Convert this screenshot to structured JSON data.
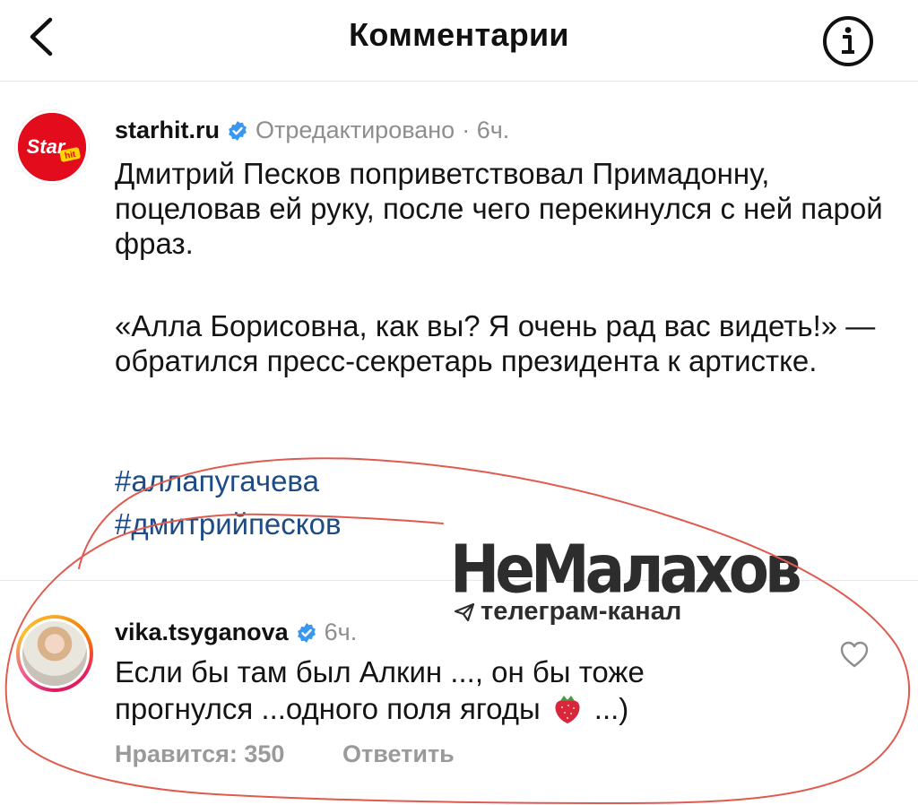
{
  "header": {
    "title": "Комментарии",
    "back_icon": "chevron-left-icon",
    "info_icon": "info-icon"
  },
  "post": {
    "avatar_text": "Star",
    "avatar_badge": "hit",
    "username": "starhit.ru",
    "edited": "Отредактировано",
    "time": "· 6ч.",
    "paragraph1": "Дмитрий Песков поприветствовал Примадонну, поцеловав ей руку, после чего перекинулся с ней парой фраз.",
    "paragraph2": "«Алла Борисовна, как вы? Я очень рад вас видеть!» — обратился пресс-секретарь президента к артистке.",
    "hashtags": [
      "#аллапугачева",
      "#дмитрийпесков"
    ]
  },
  "comment": {
    "username": "vika.tsyganova",
    "time": "6ч.",
    "text_line1": "Если бы там был Алкин ..., он бы тоже",
    "text_line2": "прогнулся ...одного поля ягоды",
    "text_line2_end": " ...)",
    "emoji": "strawberry",
    "likes": "Нравится: 350",
    "reply": "Ответить"
  },
  "watermark": {
    "title": "НеМалахов",
    "subtitle": "телеграм-канал",
    "icon": "paper-plane-icon"
  },
  "colors": {
    "hashtag": "#1d4b86",
    "verified": "#3897f0",
    "avatar_red": "#e30c1d",
    "muted": "#8e8e8e",
    "scribble": "#e05a4e"
  }
}
